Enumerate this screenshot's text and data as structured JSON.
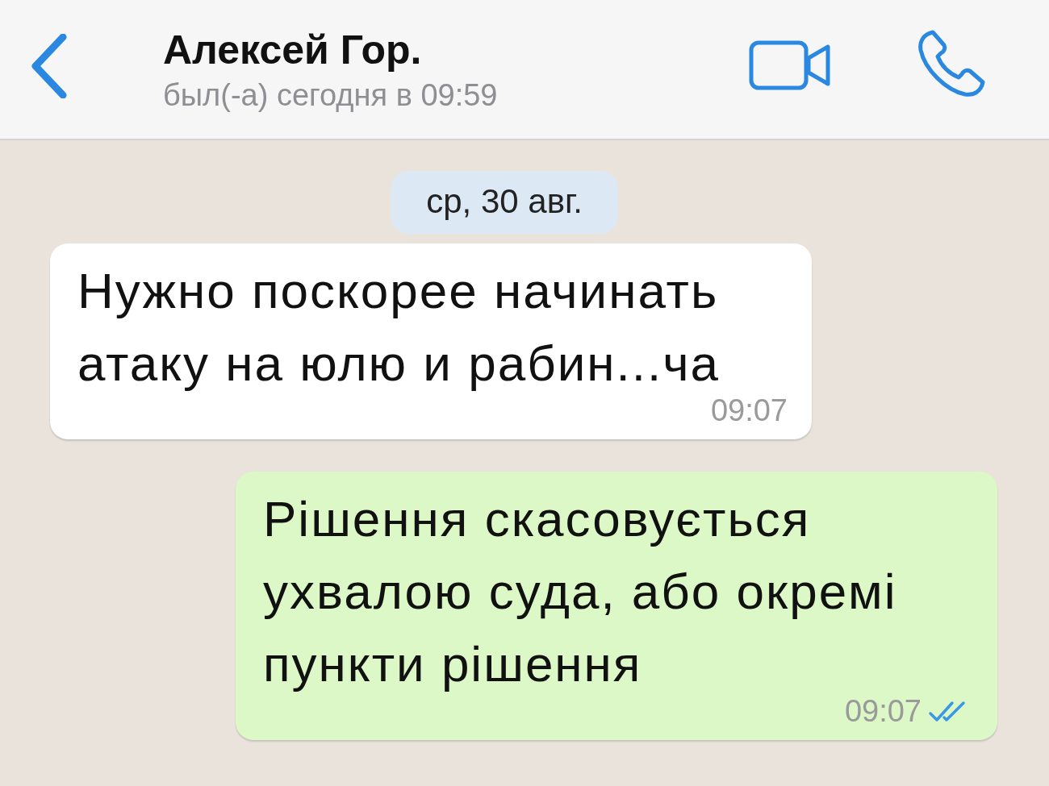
{
  "header": {
    "title": "Алексей Гор.",
    "status": "был(-а) сегодня в 09:59"
  },
  "date_pill": "ср, 30 авг.",
  "messages": [
    {
      "kind": "incoming",
      "text": "Нужно поскорее начинать атаку на юлю и рабин...ча",
      "time": "09:07",
      "read": false
    },
    {
      "kind": "outgoing",
      "text": "Рішення скасовується ухвалою суда, або окремі пункти рішення",
      "time": "09:07",
      "read": true
    }
  ]
}
